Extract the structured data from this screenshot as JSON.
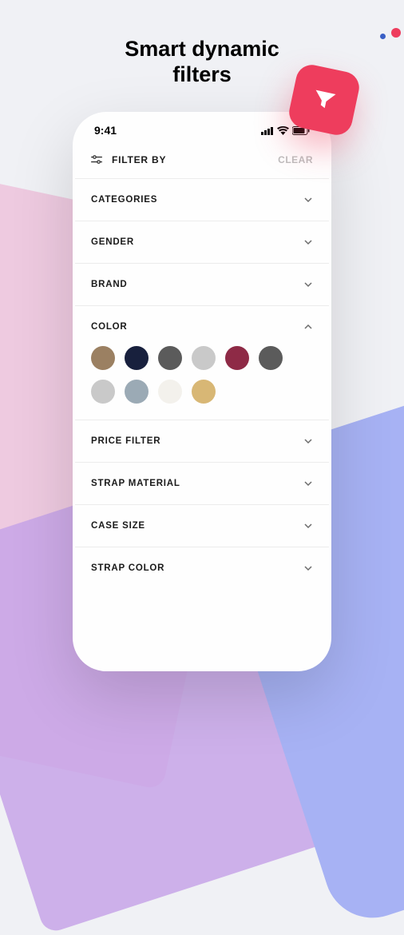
{
  "title": "Smart dynamic filters",
  "statusBar": {
    "time": "9:41"
  },
  "header": {
    "filterBy": "FILTER BY",
    "clear": "CLEAR"
  },
  "sections": {
    "categories": {
      "label": "CATEGORIES",
      "expanded": false
    },
    "gender": {
      "label": "GENDER",
      "expanded": false
    },
    "brand": {
      "label": "BRAND",
      "expanded": false
    },
    "color": {
      "label": "COLOR",
      "expanded": true,
      "swatches": [
        "#9b8062",
        "#18203d",
        "#5b5b5b",
        "#c9c9c9",
        "#8e2a46",
        "#5b5b5b",
        "#c9c9c9",
        "#9baab5",
        "#f3f1ec",
        "#d8b775"
      ]
    },
    "priceFilter": {
      "label": "PRICE FILTER",
      "expanded": false
    },
    "strapMaterial": {
      "label": "STRAP MATERIAL",
      "expanded": false
    },
    "caseSize": {
      "label": "CASE SIZE",
      "expanded": false
    },
    "strapColor": {
      "label": "STRAP COLOR",
      "expanded": false
    }
  }
}
